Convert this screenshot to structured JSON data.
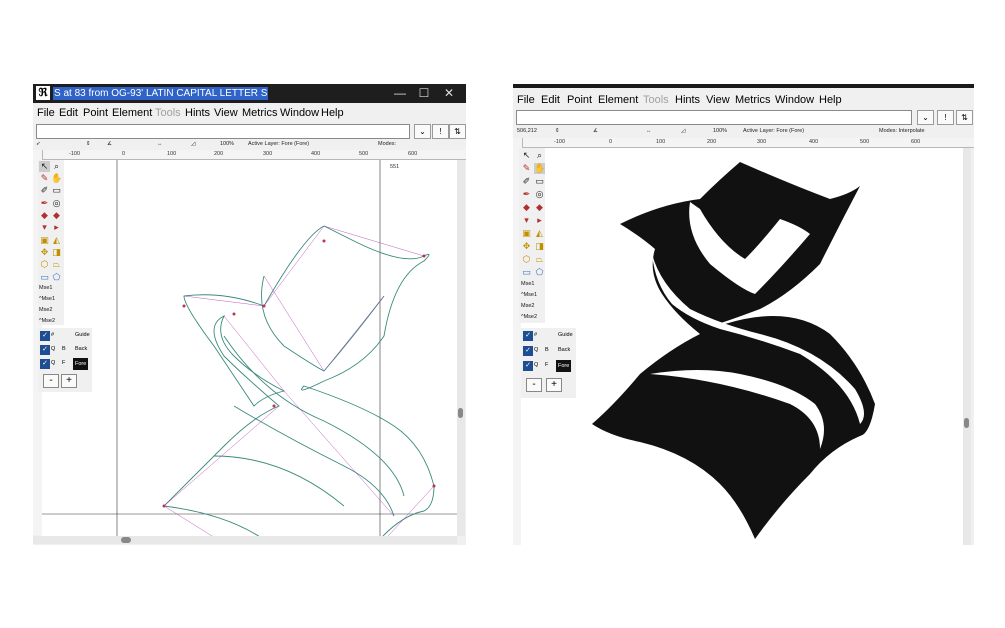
{
  "left_window": {
    "title": "S at 83 from OG-93' LATIN CAPITAL LETTER S",
    "app_icon": "fontforge-icon",
    "menu": [
      "File",
      "Edit",
      "Point",
      "Element",
      "Tools",
      "Hints",
      "View",
      "Metrics",
      "Window",
      "Help"
    ],
    "disabled_menu": "Tools",
    "info": {
      "zoom": "100%",
      "active_layer": "Active Layer: Fore (Fore)",
      "modes": "Modes:"
    },
    "ruler_ticks": [
      "-100",
      "0",
      "100",
      "200",
      "300",
      "400",
      "500",
      "600"
    ],
    "glyph_width_label": "551",
    "mse_labels": [
      "Mse1",
      "^Mse1",
      "Mse2",
      "^Mse2"
    ],
    "layers": [
      {
        "c1": "#",
        "c2": "",
        "name": "Guide"
      },
      {
        "c1": "Q",
        "c2": "B",
        "name": "Back"
      },
      {
        "c1": "Q",
        "c2": "F",
        "name": "Fore"
      }
    ],
    "buttons": {
      "minus": "-",
      "plus": "+"
    }
  },
  "right_window": {
    "menu": [
      "File",
      "Edit",
      "Point",
      "Element",
      "Tools",
      "Hints",
      "View",
      "Metrics",
      "Window",
      "Help"
    ],
    "disabled_menu": "Tools",
    "info": {
      "coords": "506,212",
      "zoom": "100%",
      "active_layer": "Active Layer: Fore (Fore)",
      "modes": "Modes: Interpolate"
    },
    "ruler_ticks": [
      "-100",
      "0",
      "100",
      "200",
      "300",
      "400",
      "500",
      "600"
    ],
    "mse_labels": [
      "Mse1",
      "^Mse1",
      "Mse2",
      "^Mse2"
    ],
    "layers": [
      {
        "c1": "#",
        "c2": "",
        "name": "Guide"
      },
      {
        "c1": "Q",
        "c2": "B",
        "name": "Back"
      },
      {
        "c1": "Q",
        "c2": "F",
        "name": "Fore"
      }
    ],
    "buttons": {
      "minus": "-",
      "plus": "+"
    }
  },
  "icons": {
    "dropdown": "chevron-down-icon",
    "info": "info-icon",
    "minimize": "minimize-icon",
    "maximize": "maximize-icon",
    "close": "close-icon"
  },
  "glyphs": {
    "minimize": "—",
    "maximize": "☐",
    "close": "✕",
    "dropdown": "⌄",
    "info1": "!",
    "info2": "⇅"
  },
  "colors": {
    "title_bg": "#1e1e1e",
    "title_highlight": "#2f63c8",
    "outline_green": "#3a8a7a",
    "control_magenta": "#b030b0",
    "glyph_fill": "#111111"
  }
}
